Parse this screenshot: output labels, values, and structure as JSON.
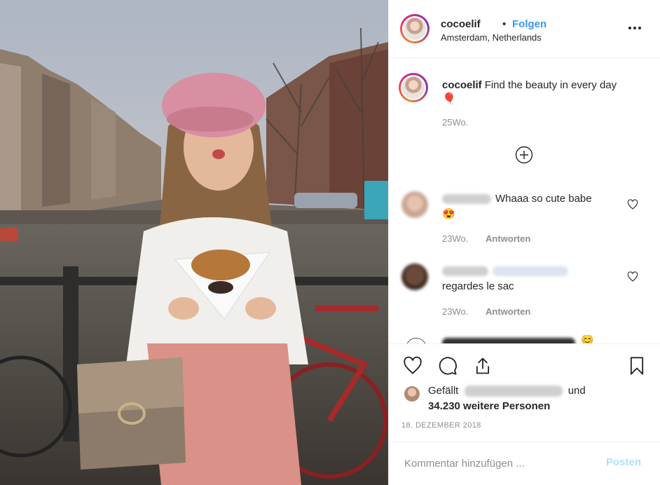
{
  "header": {
    "username": "cocoelif",
    "separator": "•",
    "follow_label": "Folgen",
    "location": "Amsterdam, Netherlands"
  },
  "caption": {
    "username": "cocoelif",
    "text": "Find the beauty in every day",
    "emoji": "🎈",
    "time": "25Wo."
  },
  "comments": [
    {
      "text": "Whaaa so cute babe",
      "emoji": "😍",
      "time": "23Wo.",
      "reply_label": "Antworten"
    },
    {
      "text": "regardes le sac",
      "time": "23Wo.",
      "reply_label": "Antworten"
    }
  ],
  "partial_comment_emoji": "😊",
  "likes": {
    "prefix": "Gefällt",
    "joiner": "und",
    "count": "34.230 weitere Personen"
  },
  "date": "18. DEZEMBER 2018",
  "add_comment": {
    "placeholder": "Kommentar hinzufügen ...",
    "post_label": "Posten"
  },
  "colors": {
    "link": "#3897f0",
    "post_disabled": "#b2dffc",
    "muted": "#8e8e8e",
    "text": "#262626"
  },
  "icons": [
    "more-options-icon",
    "load-more-comments-icon",
    "heart-icon",
    "comment-icon",
    "share-icon",
    "bookmark-icon"
  ]
}
